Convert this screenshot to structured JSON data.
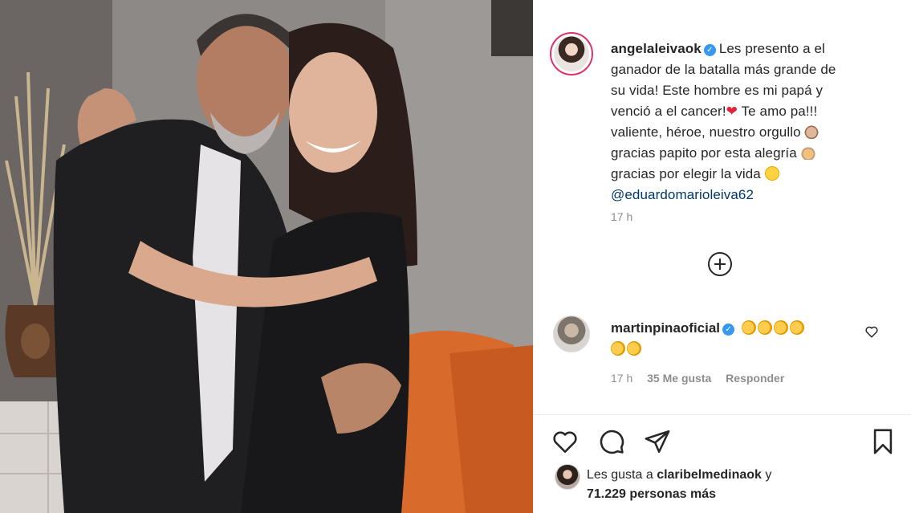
{
  "post": {
    "owner_username": "angelaleiva",
    "owner_suffix": "ok",
    "caption_lines": [
      "Les presento a el",
      "ganador de la batalla más grande de",
      "su vida! Este hombre es mi papá y",
      "venció a el cancer!",
      "Te amo pa!!!",
      "valiente, héroe, nuestro orgullo",
      "gracias papito por esta alegría",
      "gracias por elegir la vida"
    ],
    "mention": "@eduardomarioleiva62",
    "time": "17 h"
  },
  "comment": {
    "username": "martinpinaoficial",
    "time": "17 h",
    "likes": "35 Me gusta",
    "reply": "Responder"
  },
  "likes": {
    "prefix": "Les gusta a",
    "liker": "claribelmedinaok",
    "joiner": "y",
    "count_text": "71.229 personas más"
  },
  "icons": {
    "verified": "verified-badge-icon",
    "add_comments": "plus-circle-icon",
    "like": "heart-icon",
    "comment": "speech-bubble-icon",
    "share": "paper-plane-icon",
    "save": "bookmark-icon"
  },
  "colors": {
    "verified": "#3897f0",
    "mention": "#00376b",
    "secondary_text": "#8e8e8e",
    "story_ring": "#e1306c"
  }
}
